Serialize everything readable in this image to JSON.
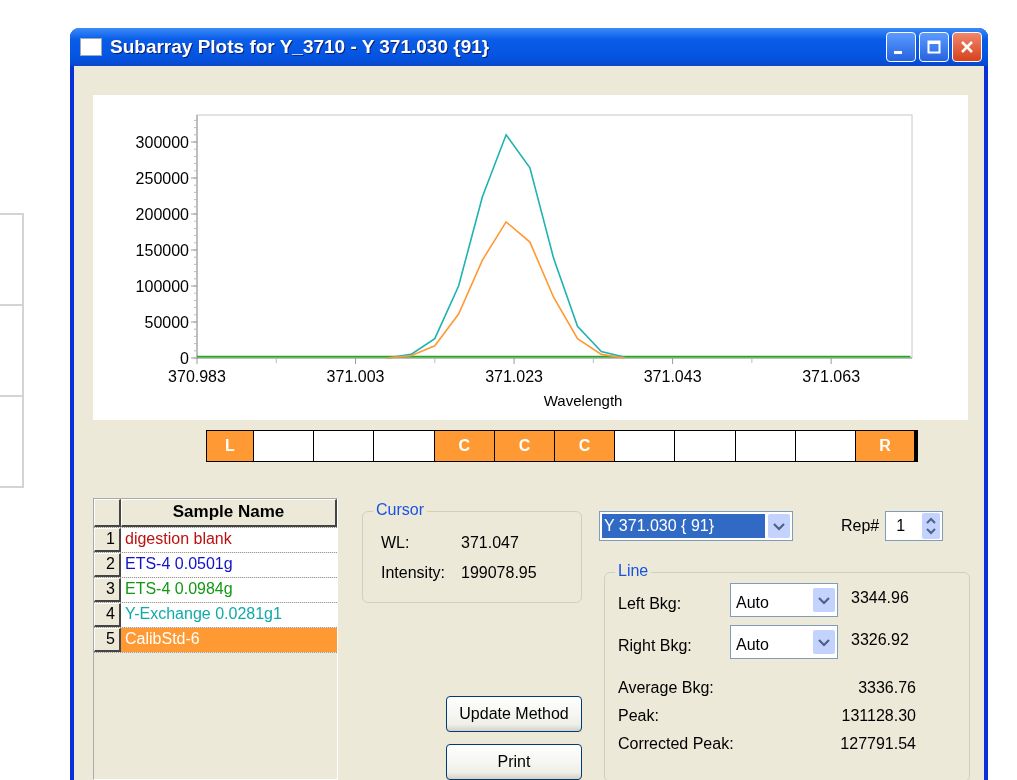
{
  "window": {
    "title": "Subarray Plots for Y_3710 - Y 371.030 {91}"
  },
  "chart": {
    "chart_data": {
      "type": "line",
      "xlabel": "Wavelength",
      "x": [
        370.983,
        370.986,
        370.989,
        370.992,
        370.995,
        370.998,
        371.001,
        371.004,
        371.007,
        371.01,
        371.013,
        371.016,
        371.019,
        371.022,
        371.025,
        371.028,
        371.031,
        371.034,
        371.037,
        371.04,
        371.043,
        371.046,
        371.049,
        371.052,
        371.055,
        371.058,
        371.061,
        371.064,
        371.067,
        371.07,
        371.073
      ],
      "xlim": [
        370.983,
        371.0732
      ],
      "ylim": [
        0,
        337500
      ],
      "xticks": [
        {
          "value": 370.983,
          "label": "370.983"
        },
        {
          "value": 371.003,
          "label": "371.003"
        },
        {
          "value": 371.023,
          "label": "371.023"
        },
        {
          "value": 371.043,
          "label": "371.043"
        },
        {
          "value": 371.063,
          "label": "371.063"
        }
      ],
      "yticks": [
        0,
        50000,
        100000,
        150000,
        200000,
        250000,
        300000
      ],
      "series": [
        {
          "color": "#22aa22",
          "values": [
            2000,
            2000,
            2000,
            2000,
            2000,
            2000,
            2000,
            2000,
            2000,
            2000,
            2000,
            2000,
            2000,
            2000,
            2000,
            2000,
            2000,
            2000,
            2000,
            2000,
            2000,
            2000,
            2000,
            2000,
            2000,
            2000,
            2000,
            2000,
            2000,
            2000,
            2000
          ]
        },
        {
          "color": "#20b2b2",
          "values": [
            null,
            null,
            null,
            null,
            null,
            null,
            null,
            null,
            0,
            5000,
            27000,
            100000,
            224000,
            310000,
            264000,
            138000,
            44000,
            9000,
            1000,
            null,
            null,
            null,
            null,
            null,
            null,
            null,
            null,
            null,
            null,
            null,
            null
          ]
        },
        {
          "color": "#ff9933",
          "values": [
            null,
            null,
            null,
            null,
            null,
            null,
            null,
            null,
            0,
            3000,
            17000,
            61000,
            136000,
            189000,
            161000,
            84000,
            27000,
            5000,
            0,
            null,
            null,
            null,
            null,
            null,
            null,
            null,
            null,
            null,
            null,
            null,
            null
          ]
        }
      ]
    }
  },
  "region_strip": [
    {
      "label": "L",
      "on": true
    },
    {
      "on": false
    },
    {
      "on": false
    },
    {
      "on": false
    },
    {
      "label": "C",
      "on": true
    },
    {
      "label": "C",
      "on": true
    },
    {
      "label": "C",
      "on": true
    },
    {
      "on": false
    },
    {
      "on": false
    },
    {
      "on": false
    },
    {
      "on": false
    },
    {
      "label": "R",
      "on": true
    }
  ],
  "sample_table": {
    "columns": [
      "Sample Name"
    ],
    "rows": [
      {
        "number": "1",
        "name": "digestion blank",
        "color": "#bb1111",
        "selected": false
      },
      {
        "number": "2",
        "name": "ETS-4 0.0501g",
        "color": "#1111cc",
        "selected": false
      },
      {
        "number": "3",
        "name": "ETS-4 0.0984g",
        "color": "#119911",
        "selected": false
      },
      {
        "number": "4",
        "name": "Y-Exchange 0.0281g1",
        "color": "#11aaaa",
        "selected": false
      },
      {
        "number": "5",
        "name": "CalibStd-6",
        "color": "#ff9933",
        "selected": true
      }
    ]
  },
  "cursor": {
    "title": "Cursor",
    "rows": [
      {
        "label": "WL:",
        "value": "371.047"
      },
      {
        "label": "Intensity:",
        "value": "199078.95"
      }
    ]
  },
  "buttons": [
    "Update Method",
    "Print"
  ],
  "line_select": {
    "value": "Y 371.030 { 91}"
  },
  "rep": {
    "label": "Rep#",
    "value": "1"
  },
  "line_group": {
    "title": "Line",
    "bkg_rows": [
      {
        "label": "Left Bkg:",
        "mode": "Auto",
        "value": "3344.96"
      },
      {
        "label": "Right Bkg:",
        "mode": "Auto",
        "value": "3326.92"
      }
    ],
    "results": [
      {
        "label": "Average Bkg:",
        "value": "3336.76"
      },
      {
        "label": "Peak:",
        "value": "131128.30"
      },
      {
        "label": "Corrected Peak:",
        "value": "127791.54"
      }
    ]
  }
}
